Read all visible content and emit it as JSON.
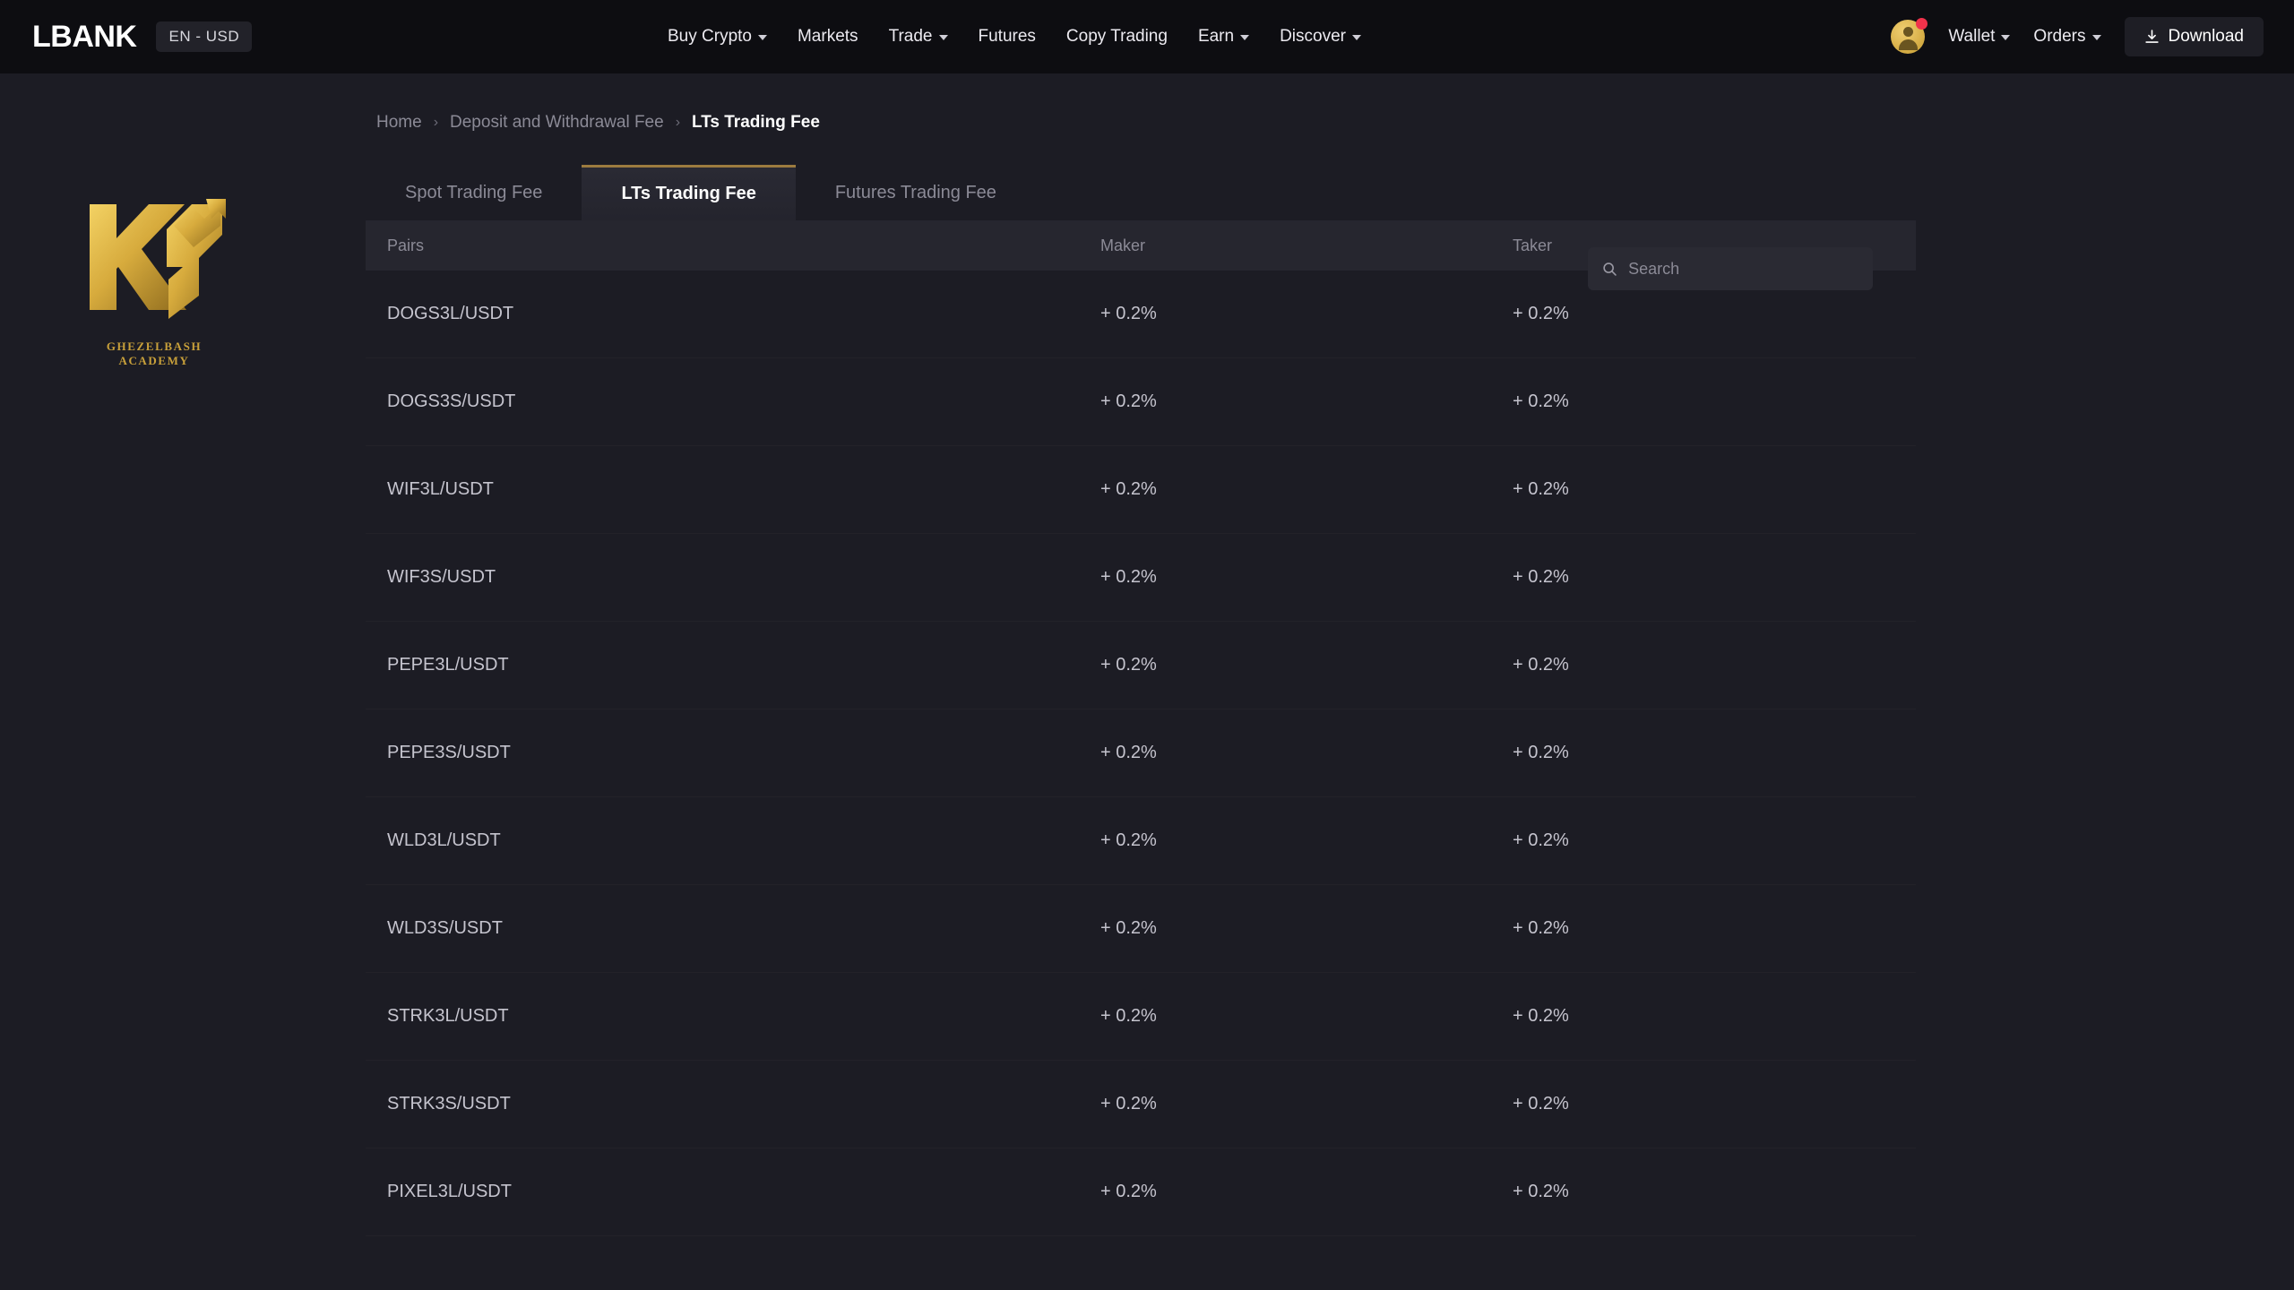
{
  "header": {
    "logo_text": "LBANK",
    "lang_chip": "EN - USD",
    "nav": [
      {
        "label": "Buy Crypto",
        "has_caret": true
      },
      {
        "label": "Markets",
        "has_caret": false
      },
      {
        "label": "Trade",
        "has_caret": true
      },
      {
        "label": "Futures",
        "has_caret": false
      },
      {
        "label": "Copy Trading",
        "has_caret": false
      },
      {
        "label": "Earn",
        "has_caret": true
      },
      {
        "label": "Discover",
        "has_caret": true
      }
    ],
    "wallet_label": "Wallet",
    "orders_label": "Orders",
    "download_label": "Download"
  },
  "watermark": {
    "monogram": "KG",
    "subtitle": "GHEZELBASH  ACADEMY"
  },
  "breadcrumb": {
    "home": "Home",
    "parent": "Deposit and Withdrawal Fee",
    "current": "LTs Trading Fee",
    "separator": "›"
  },
  "tabs": [
    {
      "label": "Spot Trading Fee",
      "active": false
    },
    {
      "label": "LTs Trading Fee",
      "active": true
    },
    {
      "label": "Futures Trading Fee",
      "active": false
    }
  ],
  "search": {
    "placeholder": "Search",
    "value": ""
  },
  "table": {
    "columns": [
      "Pairs",
      "Maker",
      "Taker"
    ],
    "rows": [
      {
        "pair": "DOGS3L/USDT",
        "maker": "+ 0.2%",
        "taker": "+ 0.2%"
      },
      {
        "pair": "DOGS3S/USDT",
        "maker": "+ 0.2%",
        "taker": "+ 0.2%"
      },
      {
        "pair": "WIF3L/USDT",
        "maker": "+ 0.2%",
        "taker": "+ 0.2%"
      },
      {
        "pair": "WIF3S/USDT",
        "maker": "+ 0.2%",
        "taker": "+ 0.2%"
      },
      {
        "pair": "PEPE3L/USDT",
        "maker": "+ 0.2%",
        "taker": "+ 0.2%"
      },
      {
        "pair": "PEPE3S/USDT",
        "maker": "+ 0.2%",
        "taker": "+ 0.2%"
      },
      {
        "pair": "WLD3L/USDT",
        "maker": "+ 0.2%",
        "taker": "+ 0.2%"
      },
      {
        "pair": "WLD3S/USDT",
        "maker": "+ 0.2%",
        "taker": "+ 0.2%"
      },
      {
        "pair": "STRK3L/USDT",
        "maker": "+ 0.2%",
        "taker": "+ 0.2%"
      },
      {
        "pair": "STRK3S/USDT",
        "maker": "+ 0.2%",
        "taker": "+ 0.2%"
      },
      {
        "pair": "PIXEL3L/USDT",
        "maker": "+ 0.2%",
        "taker": "+ 0.2%"
      }
    ]
  },
  "colors": {
    "accent_gold": "#9c7b3f",
    "logo_gold": "#d9b14a",
    "notification_red": "#f0324b",
    "header_bg": "#0d0d11",
    "page_bg": "#1c1c24"
  }
}
